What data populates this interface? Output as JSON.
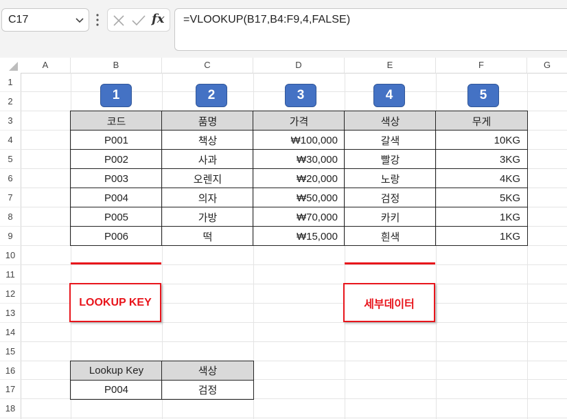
{
  "name_box": {
    "value": "C17"
  },
  "formula_bar": {
    "formula": "=VLOOKUP(B17,B4:F9,4,FALSE)",
    "fx_label": "fx"
  },
  "columns": [
    "A",
    "B",
    "C",
    "D",
    "E",
    "F",
    "G"
  ],
  "rows": [
    "1",
    "2",
    "3",
    "4",
    "5",
    "6",
    "7",
    "8",
    "9",
    "10",
    "11",
    "12",
    "13",
    "14",
    "15",
    "16",
    "17",
    "18"
  ],
  "badges": [
    "1",
    "2",
    "3",
    "4",
    "5"
  ],
  "table": {
    "headers": [
      "코드",
      "품명",
      "가격",
      "색상",
      "무게"
    ],
    "rows": [
      [
        "P001",
        "책상",
        "₩100,000",
        "갈색",
        "10KG"
      ],
      [
        "P002",
        "사과",
        "₩30,000",
        "빨강",
        "3KG"
      ],
      [
        "P003",
        "오렌지",
        "₩20,000",
        "노랑",
        "4KG"
      ],
      [
        "P004",
        "의자",
        "₩50,000",
        "검정",
        "5KG"
      ],
      [
        "P005",
        "가방",
        "₩70,000",
        "카키",
        "1KG"
      ],
      [
        "P006",
        "떡",
        "₩15,000",
        "흰색",
        "1KG"
      ]
    ]
  },
  "annotations": {
    "lookup_key": "LOOKUP KEY",
    "detail_data": "세부데이터"
  },
  "lookup_table": {
    "headers": [
      "Lookup Key",
      "색상"
    ],
    "values": [
      "P004",
      "검정"
    ]
  },
  "colors": {
    "badge": "#4472c4",
    "accent_red": "#e8141b",
    "header_fill": "#d9d9d9"
  }
}
